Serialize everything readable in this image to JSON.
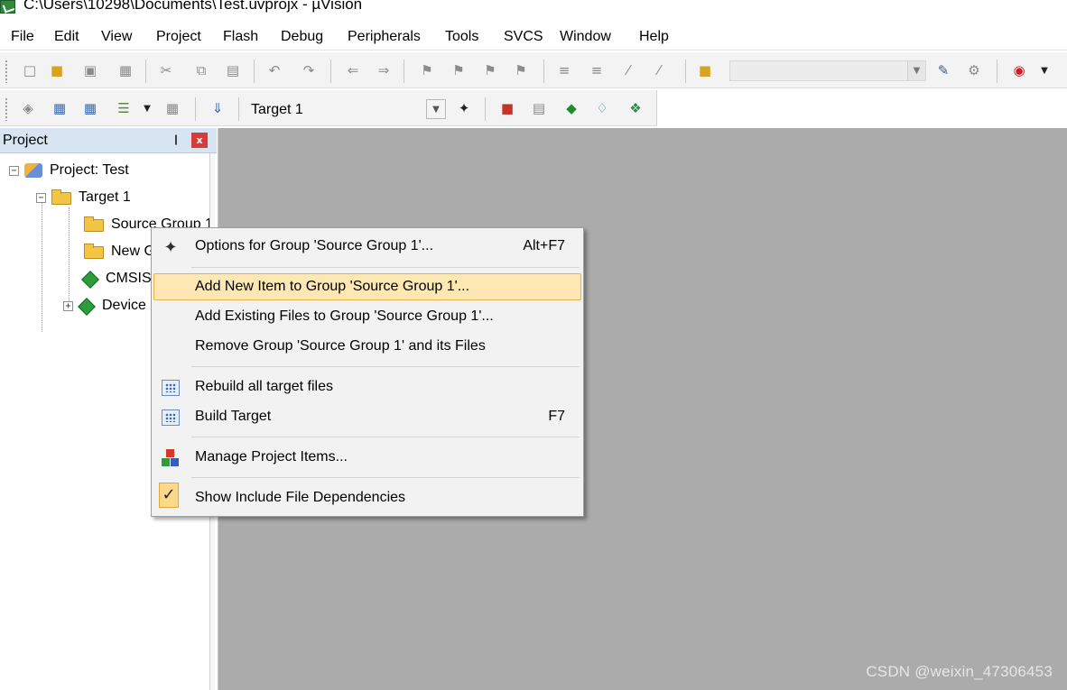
{
  "window": {
    "title": "C:\\Users\\10298\\Documents\\Test.uvprojx - µVision"
  },
  "menubar": {
    "items": [
      "File",
      "Edit",
      "View",
      "Project",
      "Flash",
      "Debug",
      "Peripherals",
      "Tools",
      "SVCS",
      "Window",
      "Help"
    ]
  },
  "toolbar2": {
    "target_name": "Target 1"
  },
  "project_pane": {
    "title": "Project",
    "pin_glyph": "❙",
    "close_glyph": "x",
    "tree": [
      {
        "label": "Project: Test",
        "expander": "−"
      },
      {
        "label": "Target 1",
        "expander": "−"
      },
      {
        "label": "Source Group 1"
      },
      {
        "label": "New Group"
      },
      {
        "label": "CMSIS"
      },
      {
        "label": "Device",
        "expander": "+"
      }
    ]
  },
  "context_menu": {
    "items": [
      {
        "icon": "magic-wand-icon",
        "label": "Options for Group 'Source Group 1'...",
        "shortcut": "Alt+F7"
      },
      {
        "label": "Add New  Item to Group 'Source Group 1'...",
        "highlighted": true
      },
      {
        "label": "Add Existing Files to Group 'Source Group 1'..."
      },
      {
        "label": "Remove Group 'Source Group 1' and its Files"
      },
      {
        "icon": "rebuild-icon",
        "label": "Rebuild all target files"
      },
      {
        "icon": "build-icon",
        "label": "Build Target",
        "shortcut": "F7"
      },
      {
        "icon": "manage-items-icon",
        "label": "Manage Project Items..."
      },
      {
        "icon": "checkmark-icon",
        "label": "Show Include File Dependencies",
        "checked": true
      }
    ]
  },
  "watermark": "CSDN @weixin_47306453",
  "colors": {
    "editor_background": "#ababab",
    "pane_header": "#d7e4f2",
    "highlight": "#fde8b4",
    "highlight_border": "#e9b14a"
  }
}
